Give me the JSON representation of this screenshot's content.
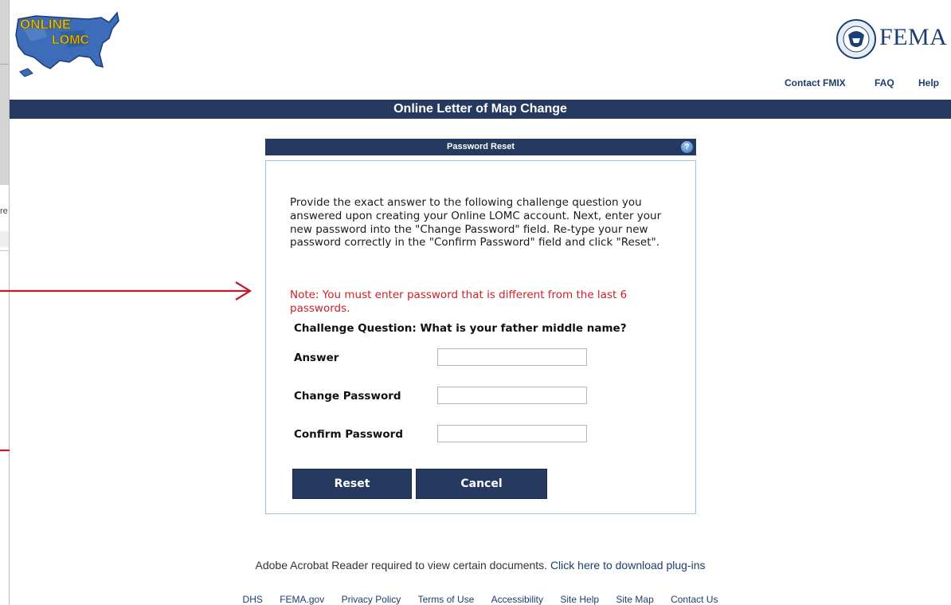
{
  "header": {
    "logo_line1": "ONLINE",
    "logo_line2": "LOMC",
    "fema_label": "FEMA",
    "nav": [
      {
        "label": "Contact FMIX"
      },
      {
        "label": "FAQ"
      },
      {
        "label": "Help"
      }
    ]
  },
  "left_fragment": "re",
  "title_bar": "Online Letter of Map Change",
  "panel": {
    "title": "Password Reset",
    "help_glyph": "?",
    "instructions": "Provide the exact answer to the following challenge question you answered upon creating your Online LOMC account. Next, enter your new password into the \"Change Password\" field. Re-type your new password correctly in the \"Confirm Password\" field and click \"Reset\".",
    "note": "Note: You must enter password that is different from the last 6 passwords.",
    "challenge_question": "Challenge Question: What is your father middle name?",
    "fields": [
      {
        "label": "Answer",
        "value": ""
      },
      {
        "label": "Change Password",
        "value": ""
      },
      {
        "label": "Confirm Password",
        "value": ""
      }
    ],
    "reset_label": "Reset",
    "cancel_label": "Cancel"
  },
  "acrobat": {
    "text": "Adobe Acrobat Reader required to view certain documents.",
    "link": "Click here to download plug-ins"
  },
  "footer_links": [
    "DHS",
    "FEMA.gov",
    "Privacy Policy",
    "Terms of Use",
    "Accessibility",
    "Site Help",
    "Site Map",
    "Contact Us"
  ],
  "colors": {
    "header_bar": "#253a5e",
    "note_red": "#cc2128",
    "arrow_red": "#c2192b",
    "link_blue": "#1c3d6e"
  }
}
